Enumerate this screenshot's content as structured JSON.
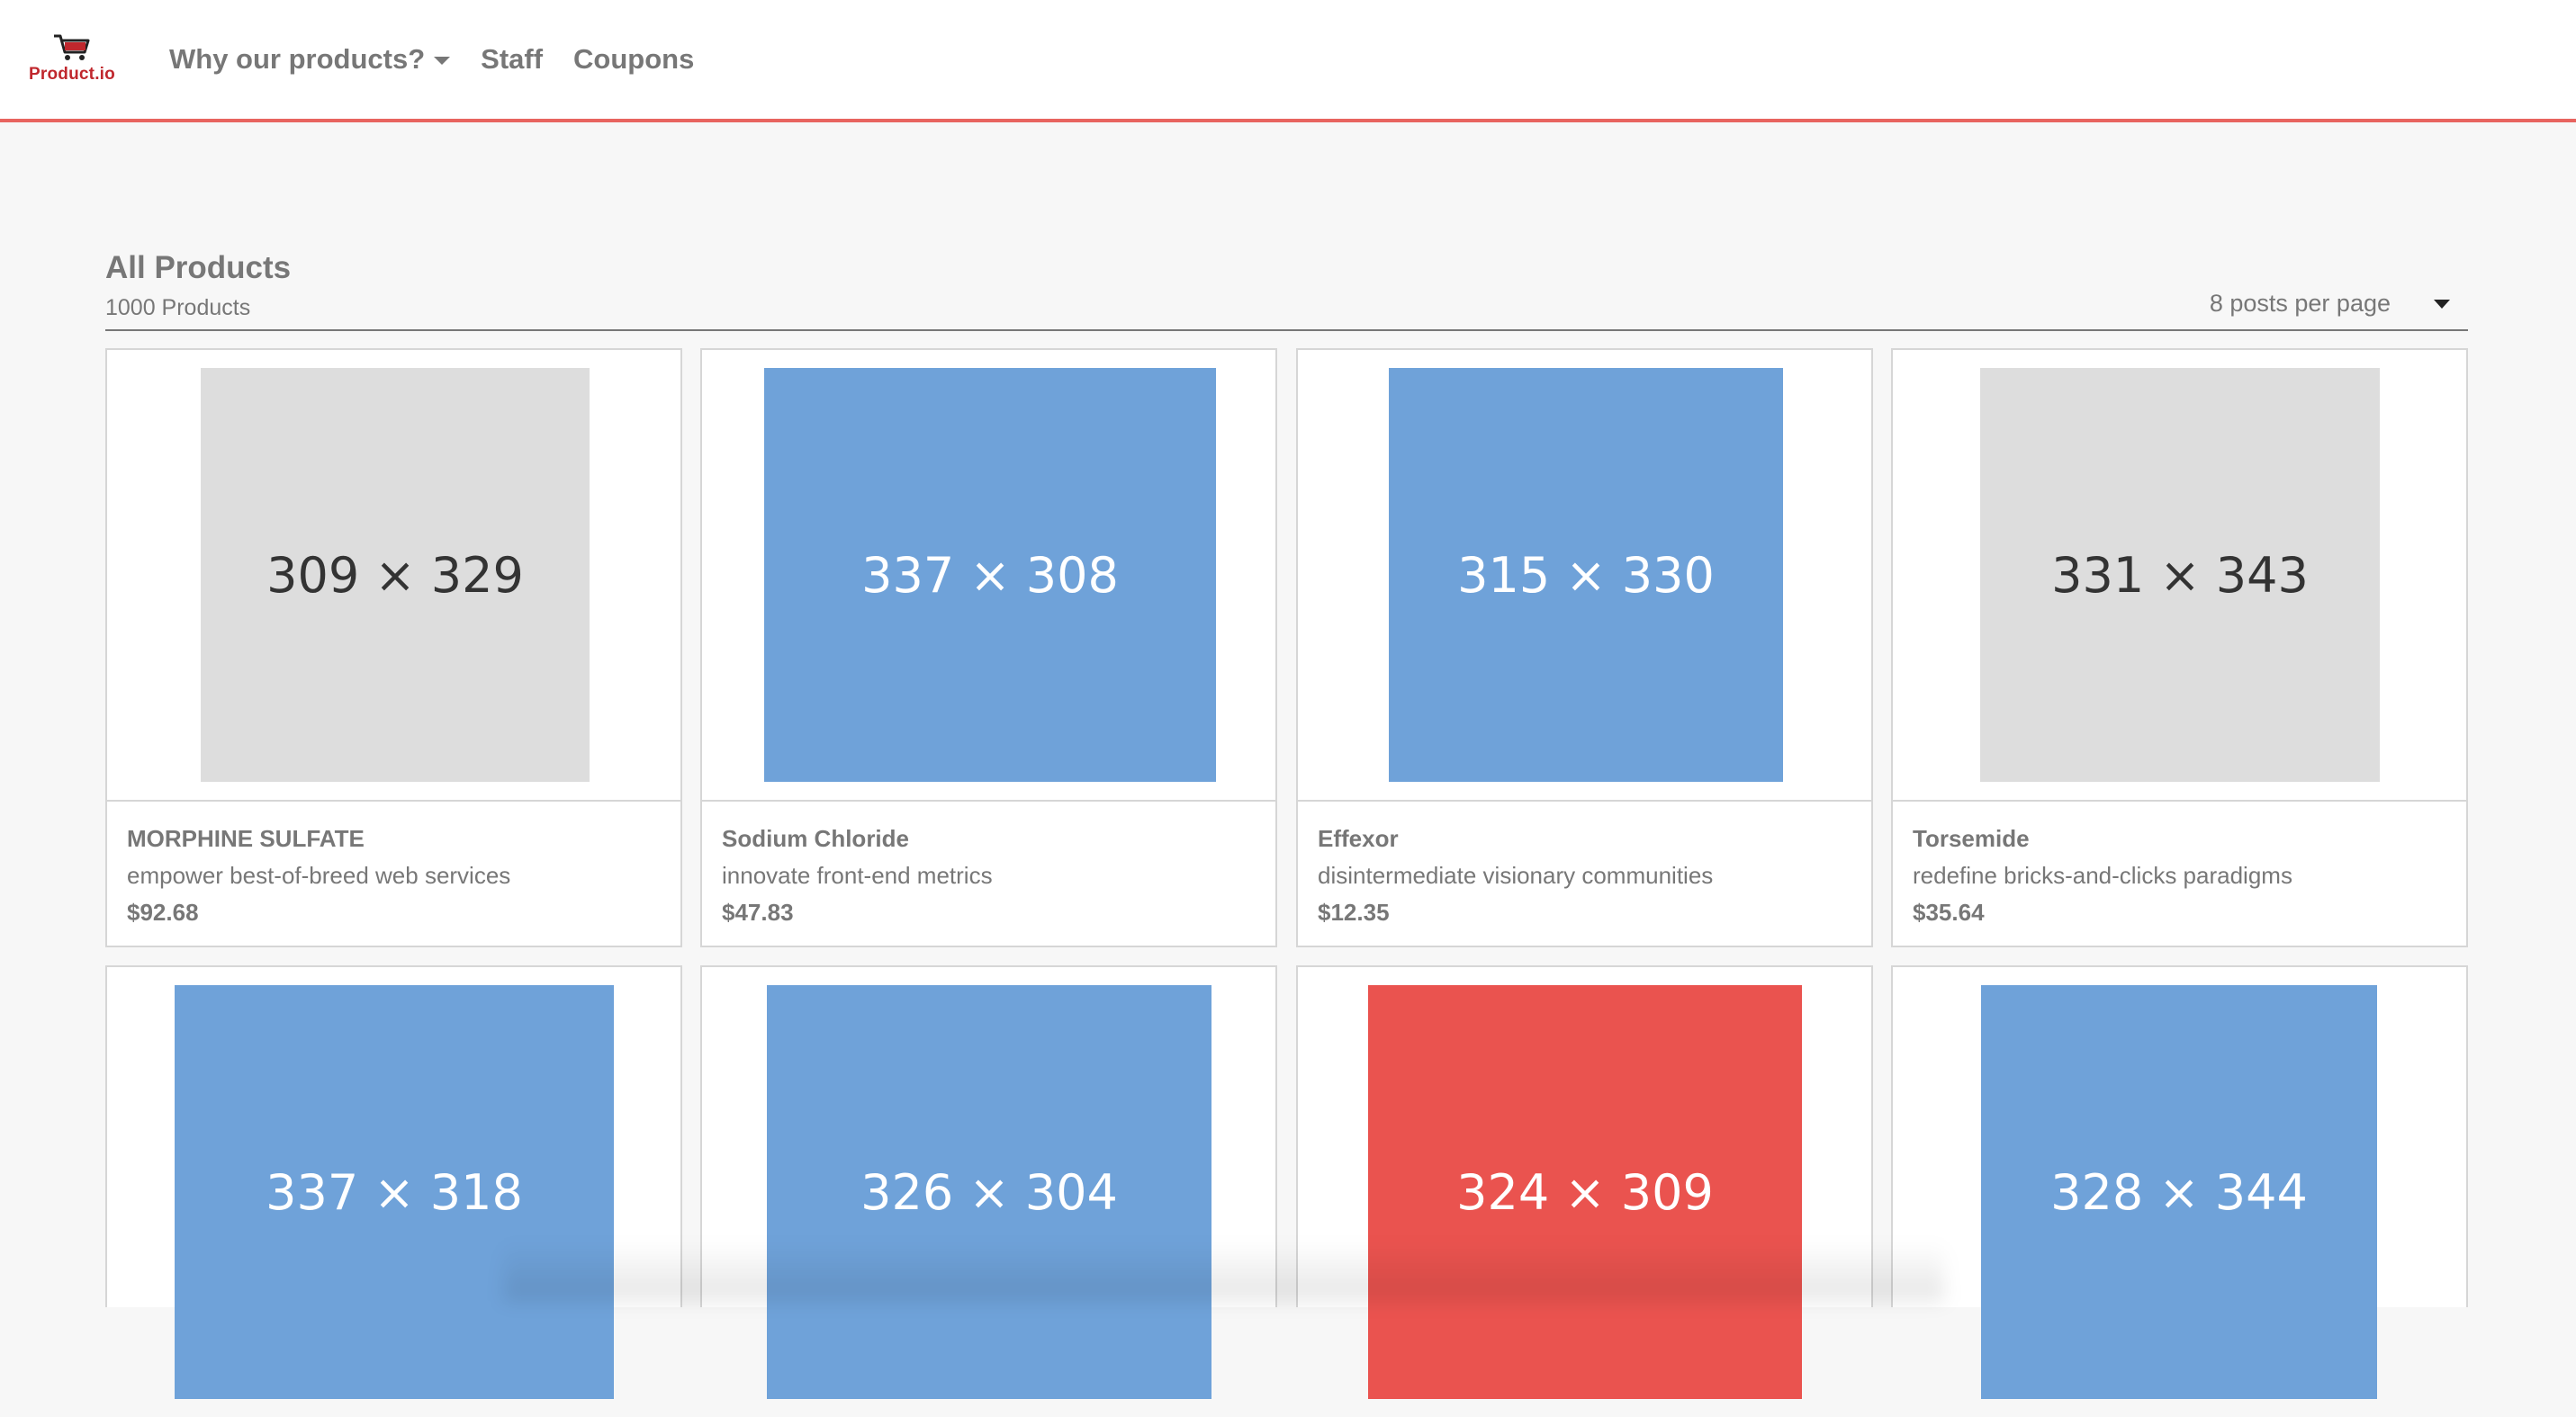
{
  "brand": {
    "name": "Product.io",
    "icon": "cart-icon",
    "color": "#c0272d"
  },
  "nav": {
    "items": [
      {
        "label": "Why our products?",
        "dropdown": true
      },
      {
        "label": "Staff",
        "dropdown": false
      },
      {
        "label": "Coupons",
        "dropdown": false
      }
    ],
    "accent_border": "#e8645f"
  },
  "main": {
    "title": "All Products",
    "count": "1000 Products",
    "per_page_selected": "8 posts per page"
  },
  "products": [
    {
      "name": "MORPHINE SULFATE",
      "description": "empower best-of-breed web services",
      "price": "$92.68",
      "image_label": "309 × 329",
      "image_color": "#dddddd",
      "image_text_color": "#333333"
    },
    {
      "name": "Sodium Chloride",
      "description": "innovate front-end metrics",
      "price": "$47.83",
      "image_label": "337 × 308",
      "image_color": "#6fa2d9",
      "image_text_color": "#ffffff"
    },
    {
      "name": "Effexor",
      "description": "disintermediate visionary communities",
      "price": "$12.35",
      "image_label": "315 × 330",
      "image_color": "#6fa2d9",
      "image_text_color": "#ffffff"
    },
    {
      "name": "Torsemide",
      "description": "redefine bricks-and-clicks paradigms",
      "price": "$35.64",
      "image_label": "331 × 343",
      "image_color": "#dddddd",
      "image_text_color": "#333333"
    },
    {
      "image_label": "337 × 318",
      "image_color": "#6fa2d9",
      "image_text_color": "#ffffff"
    },
    {
      "image_label": "326 × 304",
      "image_color": "#6fa2d9",
      "image_text_color": "#ffffff"
    },
    {
      "image_label": "324 × 309",
      "image_color": "#ea534f",
      "image_text_color": "#ffffff"
    },
    {
      "image_label": "328 × 344",
      "image_color": "#6fa2d9",
      "image_text_color": "#ffffff"
    }
  ]
}
